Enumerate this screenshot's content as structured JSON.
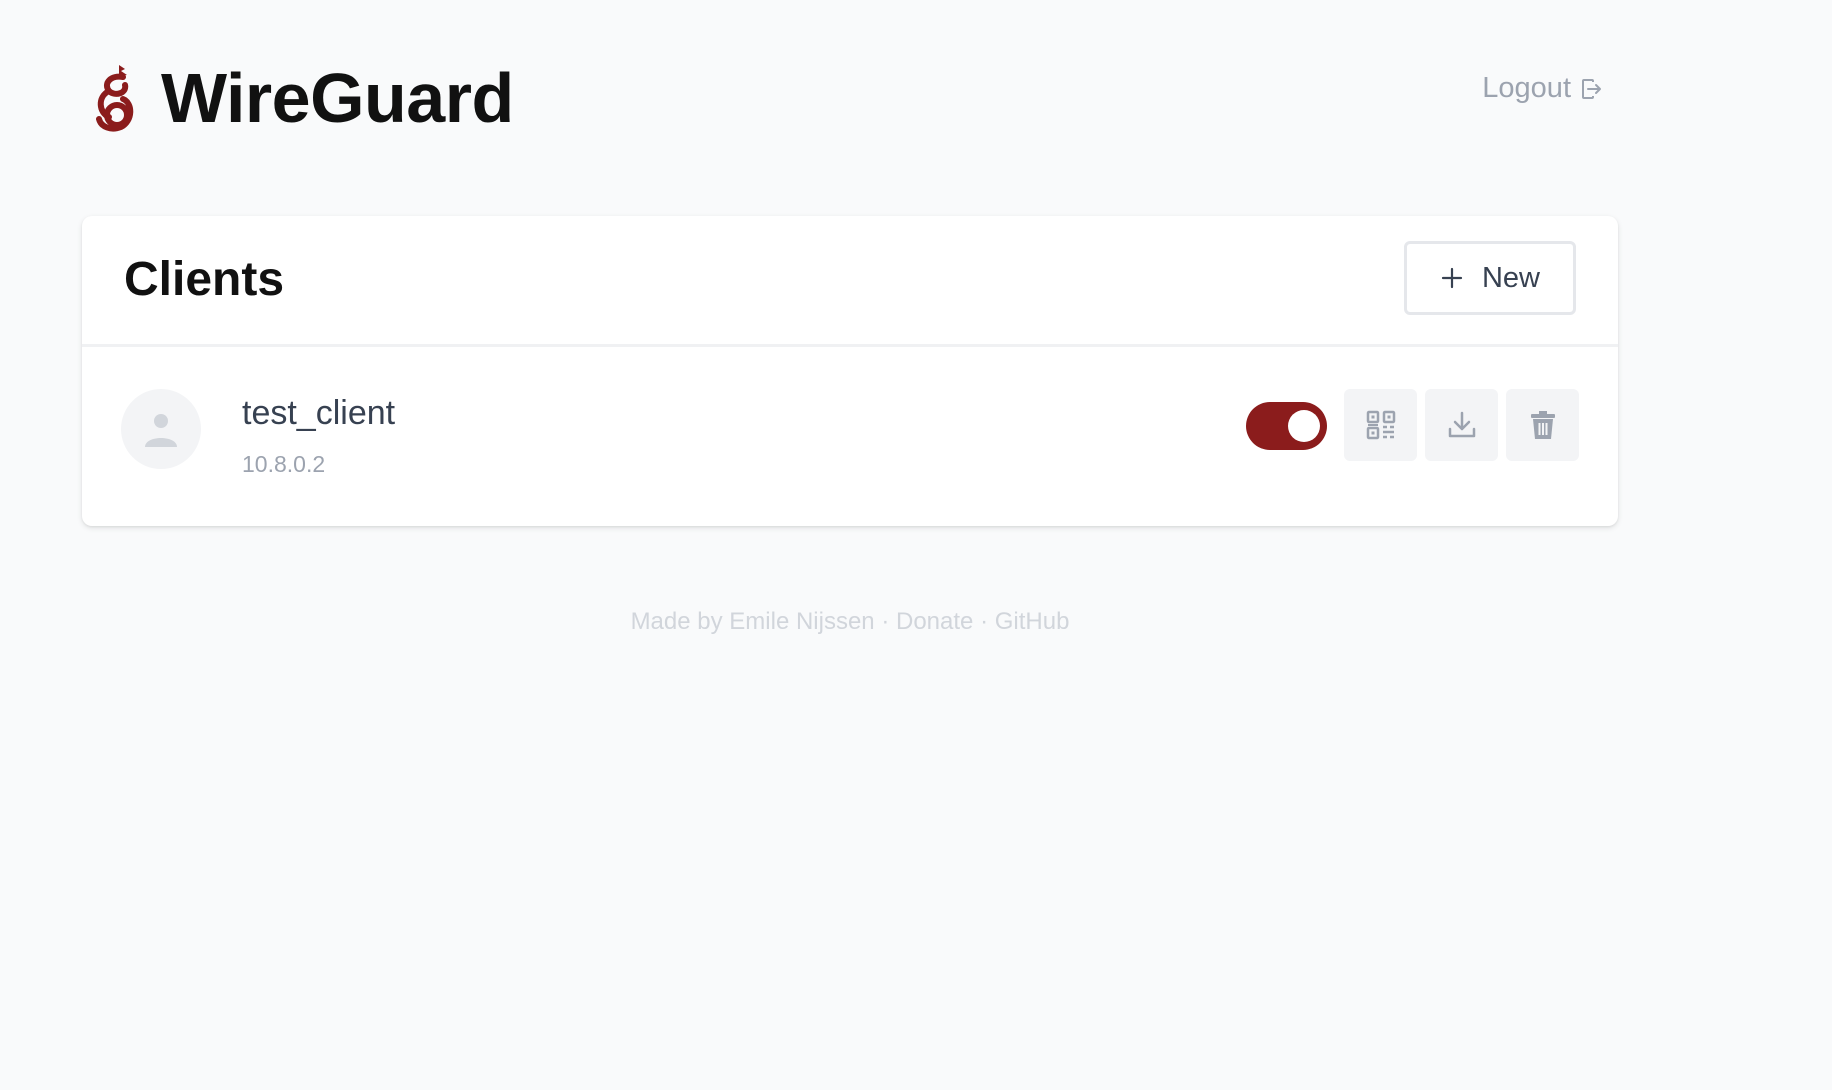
{
  "header": {
    "title": "WireGuard",
    "logo_icon": "wireguard-dragon-icon",
    "logout_label": "Logout",
    "logout_icon": "logout-icon"
  },
  "clients_card": {
    "title": "Clients",
    "new_button_label": "New",
    "new_button_icon": "plus-icon",
    "clients": [
      {
        "name": "test_client",
        "address": "10.8.0.2",
        "enabled": true,
        "avatar_icon": "user-icon",
        "actions": [
          "qr-code-icon",
          "download-icon",
          "trash-icon"
        ]
      }
    ]
  },
  "footer": {
    "made_by": "Made by Emile Nijssen",
    "separator": "·",
    "donate": "Donate",
    "github": "GitHub"
  },
  "colors": {
    "accent": "#8b1c1c",
    "background": "#f9fafb",
    "muted_text": "#9ca3af"
  }
}
